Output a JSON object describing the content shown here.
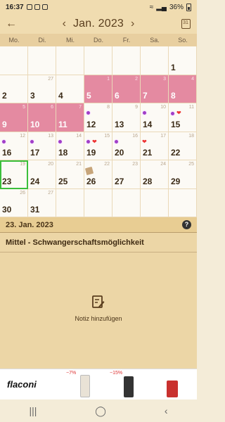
{
  "status": {
    "time": "16:37",
    "battery": "36%"
  },
  "header": {
    "month": "Jan. 2023",
    "prev": "‹",
    "next": "›",
    "back": "←",
    "today_label": "31"
  },
  "weekdays": [
    "Mo.",
    "Di.",
    "Mi.",
    "Do.",
    "Fr.",
    "Sa.",
    "So."
  ],
  "days": [
    {
      "n": "",
      "c": "",
      "pink": false
    },
    {
      "n": "",
      "c": "",
      "pink": false
    },
    {
      "n": "",
      "c": "",
      "pink": false
    },
    {
      "n": "",
      "c": "",
      "pink": false
    },
    {
      "n": "",
      "c": "",
      "pink": false
    },
    {
      "n": "",
      "c": "",
      "pink": false
    },
    {
      "n": "1",
      "c": "",
      "pink": false
    },
    {
      "n": "2",
      "c": "",
      "pink": false
    },
    {
      "n": "3",
      "c": "27",
      "pink": false
    },
    {
      "n": "4",
      "c": "",
      "pink": false
    },
    {
      "n": "5",
      "c": "1",
      "pink": true
    },
    {
      "n": "6",
      "c": "2",
      "pink": true
    },
    {
      "n": "7",
      "c": "3",
      "pink": true
    },
    {
      "n": "8",
      "c": "4",
      "pink": true
    },
    {
      "n": "9",
      "c": "5",
      "pink": true
    },
    {
      "n": "10",
      "c": "6",
      "pink": true
    },
    {
      "n": "11",
      "c": "7",
      "pink": true
    },
    {
      "n": "12",
      "c": "8",
      "pink": false,
      "marks": [
        "dot"
      ]
    },
    {
      "n": "13",
      "c": "9",
      "pink": false
    },
    {
      "n": "14",
      "c": "10",
      "pink": false,
      "marks": [
        "dot"
      ]
    },
    {
      "n": "15",
      "c": "11",
      "pink": false,
      "marks": [
        "dot",
        "heart"
      ]
    },
    {
      "n": "16",
      "c": "12",
      "pink": false,
      "marks": [
        "dot"
      ]
    },
    {
      "n": "17",
      "c": "13",
      "pink": false,
      "marks": [
        "dot"
      ]
    },
    {
      "n": "18",
      "c": "14",
      "pink": false,
      "marks": [
        "dot"
      ]
    },
    {
      "n": "19",
      "c": "15",
      "pink": false,
      "marks": [
        "dot",
        "heart"
      ]
    },
    {
      "n": "20",
      "c": "16",
      "pink": false,
      "marks": [
        "dot"
      ]
    },
    {
      "n": "21",
      "c": "17",
      "pink": false,
      "marks": [
        "heart"
      ]
    },
    {
      "n": "22",
      "c": "18",
      "pink": false
    },
    {
      "n": "23",
      "c": "19",
      "pink": false,
      "sel": true
    },
    {
      "n": "24",
      "c": "20",
      "pink": false
    },
    {
      "n": "25",
      "c": "21",
      "pink": false
    },
    {
      "n": "26",
      "c": "22",
      "pink": false,
      "marks": [
        "note"
      ]
    },
    {
      "n": "27",
      "c": "23",
      "pink": false
    },
    {
      "n": "28",
      "c": "24",
      "pink": false
    },
    {
      "n": "29",
      "c": "25",
      "pink": false
    },
    {
      "n": "30",
      "c": "26",
      "pink": false
    },
    {
      "n": "31",
      "c": "27",
      "pink": false
    },
    {
      "n": "",
      "c": "",
      "pink": false
    },
    {
      "n": "",
      "c": "",
      "pink": false
    },
    {
      "n": "",
      "c": "",
      "pink": false
    },
    {
      "n": "",
      "c": "",
      "pink": false
    },
    {
      "n": "",
      "c": "",
      "pink": false
    }
  ],
  "info": {
    "date": "23. Jan. 2023",
    "fertility": "Mittel - Schwangerschaftsmöglichkeit",
    "add_note": "Notiz hinzufügen",
    "help": "?"
  },
  "ad": {
    "brand": "flaconi",
    "badge1": "−7%",
    "badge2": "−15%"
  },
  "colors": {
    "period": "#e48aa1",
    "selected": "#3bbf3b",
    "accent": "#6b4d2a"
  }
}
